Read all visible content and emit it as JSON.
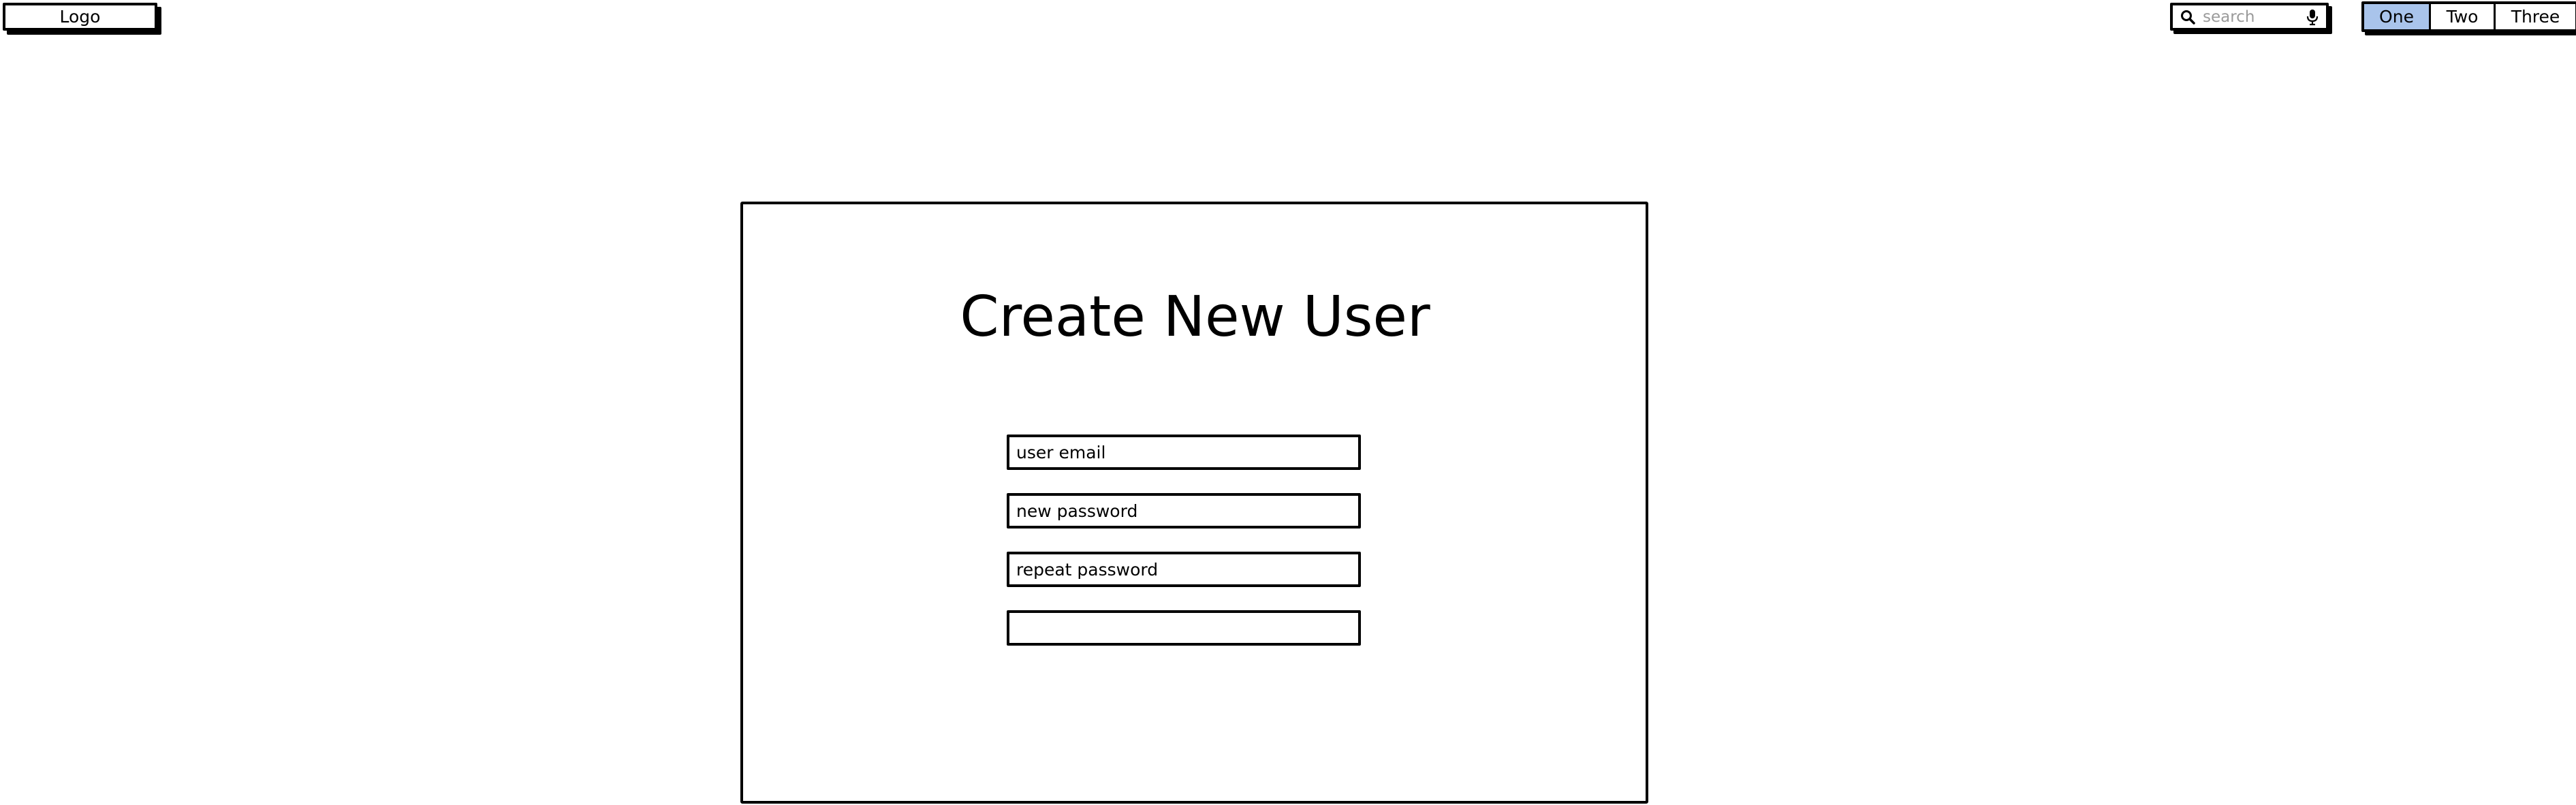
{
  "header": {
    "logo_label": "Logo",
    "search": {
      "placeholder": "search",
      "value": "",
      "icon": "search-icon",
      "mic_icon": "microphone-icon"
    },
    "tabs": [
      {
        "label": "One",
        "selected": true
      },
      {
        "label": "Two",
        "selected": false
      },
      {
        "label": "Three",
        "selected": false
      }
    ],
    "selected_tab_color": "#a9c4eb"
  },
  "form": {
    "title": "Create New User",
    "fields": [
      {
        "placeholder": "user email",
        "value": ""
      },
      {
        "placeholder": "new password",
        "value": ""
      },
      {
        "placeholder": "repeat password",
        "value": ""
      },
      {
        "placeholder": "",
        "value": ""
      }
    ]
  }
}
